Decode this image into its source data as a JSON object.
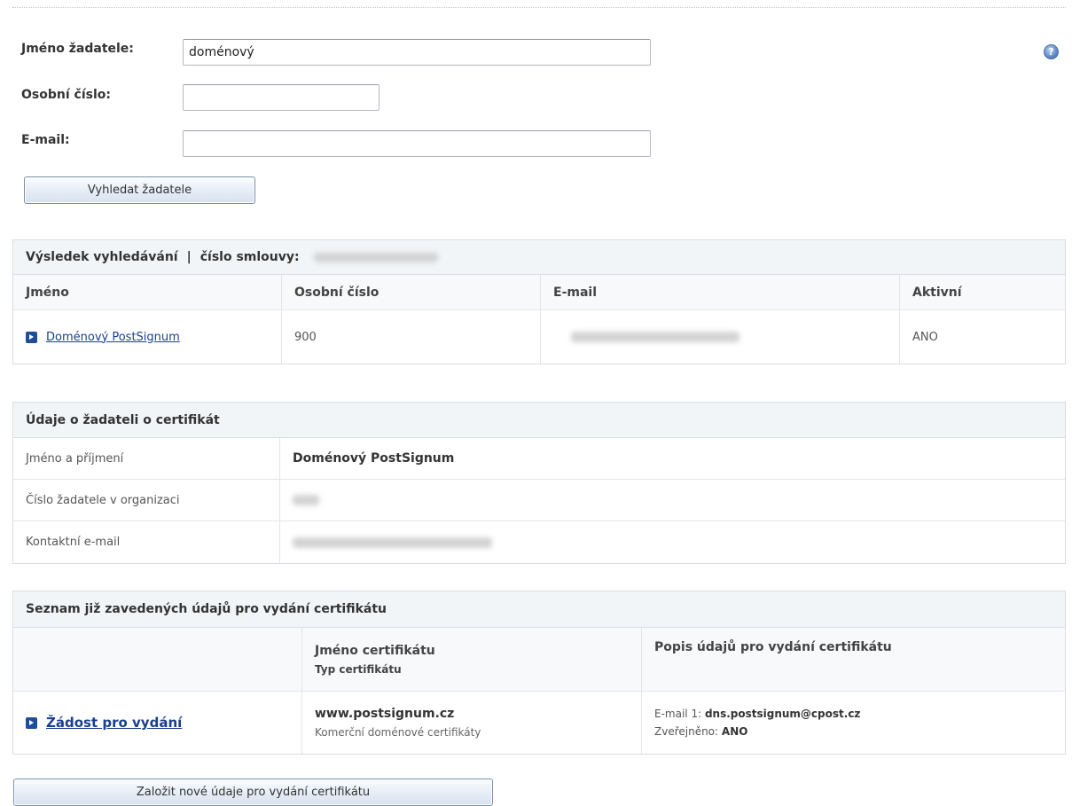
{
  "form": {
    "name_label": "Jméno žadatele:",
    "name_value": "doménový",
    "number_label": "Osobní číslo:",
    "number_value": "",
    "email_label": "E-mail:",
    "email_value": "",
    "search_button": "Vyhledat žadatele",
    "help_icon": "question-icon",
    "help_glyph": "?"
  },
  "results": {
    "title": "Výsledek vyhledávání",
    "separator": "|",
    "contract_label": "číslo smlouvy:",
    "columns": [
      "Jméno",
      "Osobní číslo",
      "E-mail",
      "Aktivní"
    ],
    "rows": [
      {
        "name": "Doménový PostSignum",
        "number": "900",
        "active": "ANO"
      }
    ]
  },
  "applicant": {
    "title": "Údaje o žadateli o certifikát",
    "rows": [
      {
        "label": "Jméno a příjmení",
        "value": "Doménový PostSignum"
      },
      {
        "label": "Číslo žadatele v organizaci",
        "value": ""
      },
      {
        "label": "Kontaktní e-mail",
        "value": ""
      }
    ]
  },
  "certificates": {
    "title": "Seznam již zavedených údajů pro vydání certifikátu",
    "col_name": "Jméno certifikátu",
    "col_type": "Typ certifikátu",
    "col_desc": "Popis údajů pro vydání certifikátu",
    "rows": [
      {
        "link": "Žádost pro vydání",
        "cert_name": "www.postsignum.cz",
        "cert_type": "Komerční doménové certifikáty",
        "email_label": "E-mail 1:",
        "email_value": "dns.postsignum@cpost.cz",
        "published_label": "Zveřejněno:",
        "published_value": "ANO"
      }
    ]
  },
  "new_button": "Založit nové údaje pro vydání certifikátu",
  "colors": {
    "accent": "#1e4f96",
    "link": "#1a3f8f",
    "header_bg": "#f2f5f8"
  }
}
